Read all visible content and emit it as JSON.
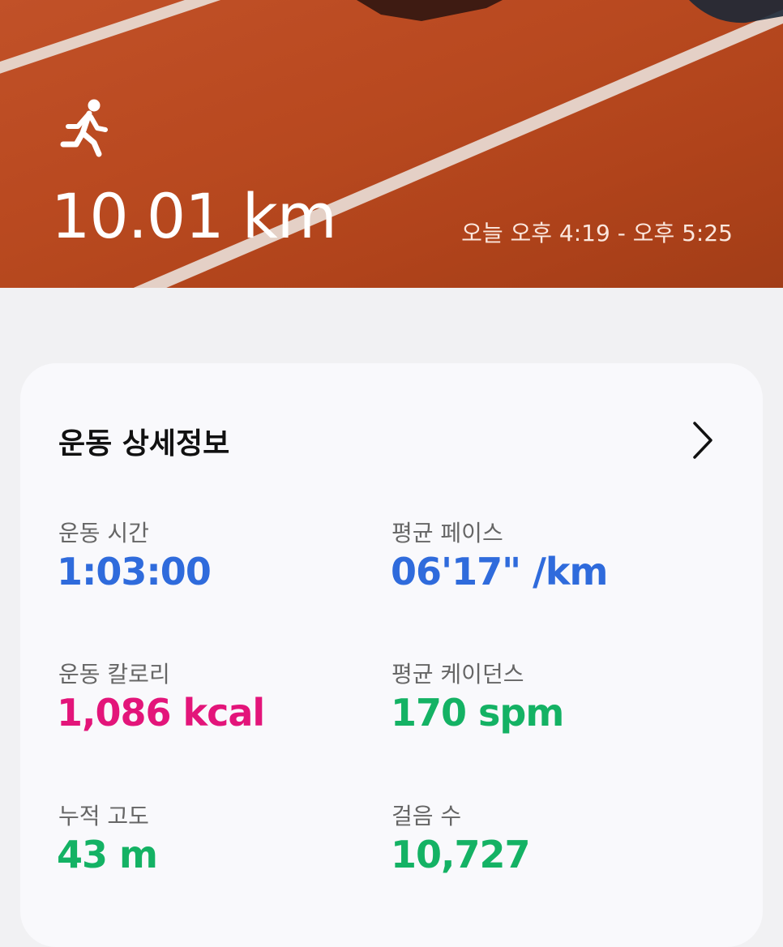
{
  "header": {
    "icon": "running-person-icon",
    "distance": "10.01 km",
    "time_range": "오늘 오후 4:19 - 오후 5:25"
  },
  "details": {
    "title": "운동 상세정보",
    "chevron_icon": "chevron-right-icon",
    "stats": {
      "duration": {
        "label": "운동 시간",
        "value": "1:03:00"
      },
      "pace": {
        "label": "평균 페이스",
        "value": "06'17\" /km"
      },
      "calories": {
        "label": "운동 칼로리",
        "value": "1,086 kcal"
      },
      "cadence": {
        "label": "평균 케이던스",
        "value": "170 spm"
      },
      "elevation": {
        "label": "누적 고도",
        "value": "43 m"
      },
      "steps": {
        "label": "걸음 수",
        "value": "10,727"
      }
    }
  },
  "colors": {
    "track": "#c14d22",
    "blue": "#2f6bdc",
    "pink": "#e3157a",
    "green": "#14b264"
  }
}
